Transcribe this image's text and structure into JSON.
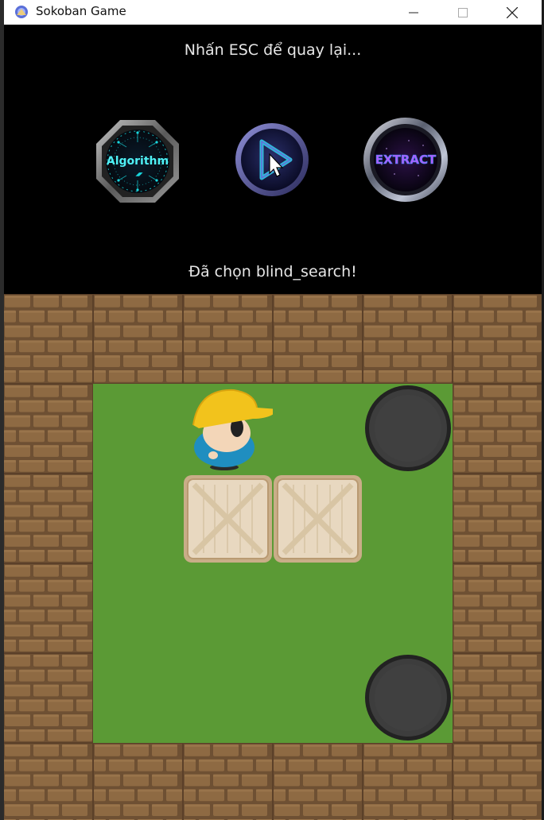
{
  "window": {
    "title": "Sokoban Game",
    "controls": [
      "minimize",
      "maximize",
      "close"
    ]
  },
  "hud": {
    "hint": "Nhấn ESC để quay lại...",
    "status": "Đã chọn blind_search!",
    "buttons": [
      {
        "id": "algorithm",
        "label": "Algorithm",
        "icon": "circuit-icon",
        "color": "#19d9e0"
      },
      {
        "id": "play",
        "label": "",
        "icon": "play-icon",
        "color": "#2fb8d8"
      },
      {
        "id": "extract",
        "label": "EXTRACT",
        "icon": "extract-icon",
        "color": "#b35cff"
      }
    ]
  },
  "colors": {
    "brick": "#8e6a43",
    "brick_mortar": "#6e5033",
    "grass": "#5b9a35",
    "goal": "#3d3d3d",
    "crate": "#e8d8c0",
    "helmet": "#f2c31c"
  },
  "board": {
    "cols": 6,
    "rows": 6,
    "legend": {
      "W": "wall",
      "F": "floor",
      "P": "player",
      "B": "box",
      "G": "goal"
    },
    "grid": [
      [
        "W",
        "W",
        "W",
        "W",
        "W",
        "W"
      ],
      [
        "W",
        "F",
        "P",
        "F",
        "G",
        "W"
      ],
      [
        "W",
        "F",
        "B",
        "B",
        "F",
        "W"
      ],
      [
        "W",
        "F",
        "F",
        "F",
        "F",
        "W"
      ],
      [
        "W",
        "F",
        "F",
        "F",
        "G",
        "W"
      ],
      [
        "W",
        "W",
        "W",
        "W",
        "W",
        "W"
      ]
    ]
  }
}
